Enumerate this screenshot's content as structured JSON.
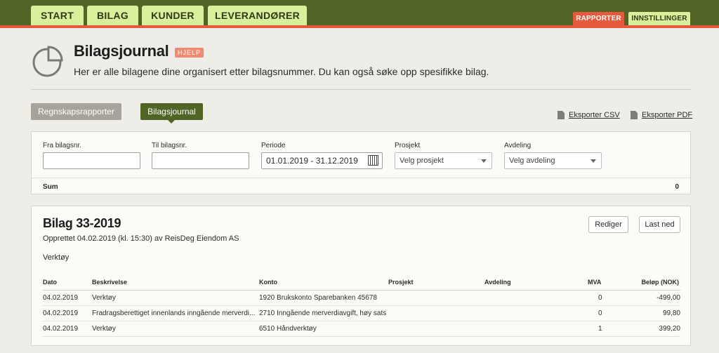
{
  "nav": {
    "tabs": [
      "START",
      "BILAG",
      "KUNDER",
      "LEVERANDØRER"
    ],
    "rapporter": "RAPPORTER",
    "innstillinger": "INNSTILLINGER"
  },
  "header": {
    "title": "Bilagsjournal",
    "help": "HJELP",
    "subtitle": "Her er alle bilagene dine organisert etter bilagsnummer. Du kan også søke opp spesifikke bilag."
  },
  "subtabs": {
    "regnskap": "Regnskapsrapporter",
    "journal": "Bilagsjournal"
  },
  "exports": {
    "csv": "Eksporter CSV",
    "pdf": "Eksporter PDF",
    "csv_icon": "csv-file-icon",
    "pdf_icon": "pdf-file-icon"
  },
  "filters": {
    "fra_label": "Fra bilagsnr.",
    "fra_value": "",
    "til_label": "Til bilagsnr.",
    "til_value": "",
    "periode_label": "Periode",
    "periode_value": "01.01.2019 - 31.12.2019",
    "prosjekt_label": "Prosjekt",
    "prosjekt_value": "Velg prosjekt",
    "avdeling_label": "Avdeling",
    "avdeling_value": "Velg avdeling",
    "sum_label": "Sum",
    "sum_value": "0"
  },
  "voucher": {
    "title": "Bilag 33-2019",
    "created": "Opprettet 04.02.2019 (kl. 15:30) av ReisDeg Eiendom AS",
    "description": "Verktøy",
    "edit": "Rediger",
    "download": "Last ned",
    "columns": {
      "dato": "Dato",
      "beskrivelse": "Beskrivelse",
      "konto": "Konto",
      "prosjekt": "Prosjekt",
      "avdeling": "Avdeling",
      "mva": "MVA",
      "belop": "Beløp (NOK)"
    },
    "rows": [
      {
        "dato": "04.02.2019",
        "beskrivelse": "Verktøy",
        "konto": "1920 Brukskonto Sparebanken 45678",
        "prosjekt": "",
        "avdeling": "",
        "mva": "0",
        "belop": "-499,00"
      },
      {
        "dato": "04.02.2019",
        "beskrivelse": "Fradragsberettiget innenlands inngående merverdi...",
        "konto": "2710 Inngående merverdiavgift, høy sats",
        "prosjekt": "",
        "avdeling": "",
        "mva": "0",
        "belop": "99,80"
      },
      {
        "dato": "04.02.2019",
        "beskrivelse": "Verktøy",
        "konto": "6510 Håndverktøy",
        "prosjekt": "",
        "avdeling": "",
        "mva": "1",
        "belop": "399,20"
      }
    ]
  },
  "colors": {
    "nav_bg": "#506425",
    "nav_tab": "#d9ef9c",
    "accent_orange": "#e55a3c",
    "active_tab": "#506425",
    "inactive_tab": "#a6a39b"
  }
}
